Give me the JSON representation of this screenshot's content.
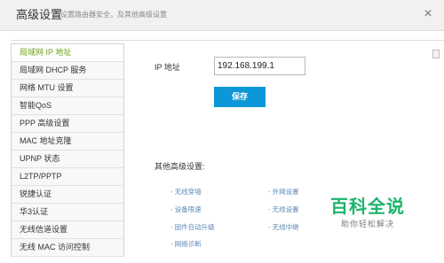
{
  "header": {
    "title": "高级设置",
    "subtitle": "设置路由器安全，及其他高级设置",
    "close": "×"
  },
  "sidebar": {
    "items": [
      {
        "label": "局域网 IP 地址",
        "active": true
      },
      {
        "label": "局域网 DHCP 服务",
        "active": false
      },
      {
        "label": "网络 MTU 设置",
        "active": false
      },
      {
        "label": "智能QoS",
        "active": false
      },
      {
        "label": "PPP 高级设置",
        "active": false
      },
      {
        "label": "MAC 地址克隆",
        "active": false
      },
      {
        "label": "UPNP 状态",
        "active": false
      },
      {
        "label": "L2TP/PPTP",
        "active": false
      },
      {
        "label": "锐捷认证",
        "active": false
      },
      {
        "label": "华3认证",
        "active": false
      },
      {
        "label": "无线信道设置",
        "active": false
      },
      {
        "label": "无线 MAC 访问控制",
        "active": false
      }
    ],
    "active_color": "#6fa318"
  },
  "main": {
    "ip_label": "IP 地址",
    "ip_value": "192.168.199.1",
    "save_label": "保存",
    "save_color": "#0e97d8",
    "other_title": "其他高级设置:",
    "links": {
      "wireless_relay": "- 无线穿墙",
      "wan_settings": "- 外网设置",
      "device_limit": "- 设备限速",
      "wireless_settings": "- 无线设置",
      "auto_upgrade": "- 固件自动升级",
      "wireless_bridge": "- 无线中继",
      "network_diagnosis": "- 网络诊断"
    },
    "link_color": "#5c8ab6"
  },
  "watermark": {
    "logo_text": "百科全说",
    "tagline": "助你轻松解决"
  }
}
